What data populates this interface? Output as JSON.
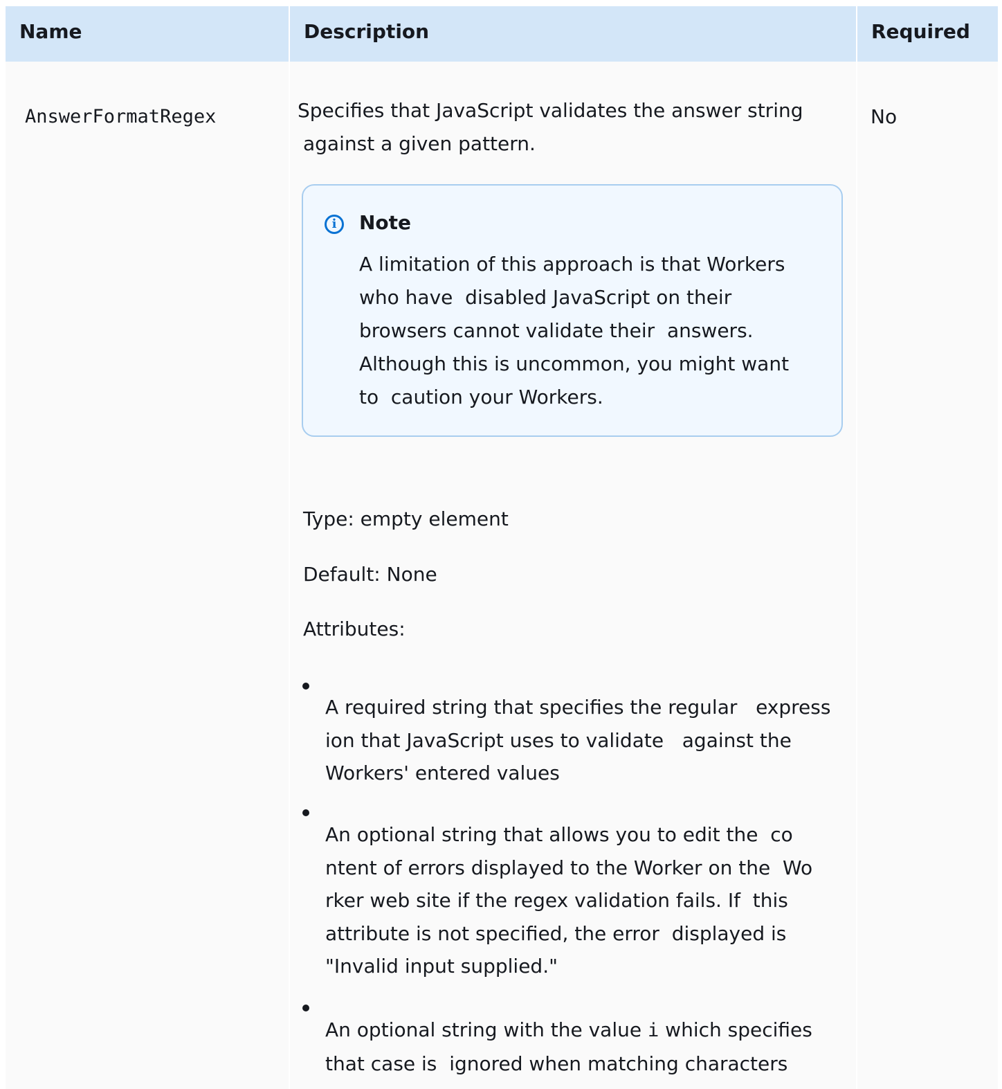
{
  "header": {
    "name": "Name",
    "description": "Description",
    "required": "Required"
  },
  "row": {
    "name": "AnswerFormatRegex",
    "required": "No",
    "intro_line1": "Specifies that JavaScript validates the answer string",
    "intro_line2": "against a given pattern.",
    "note": {
      "title": "Note",
      "lines": [
        "A limitation of this approach is that Workers",
        "who have  disabled JavaScript on their",
        "browsers cannot validate their  answers.",
        "Although this is uncommon, you might want",
        "to  caution your Workers."
      ]
    },
    "type_text": "Type: empty element",
    "default_text": "Default: None",
    "attributes_label": "Attributes:",
    "list": [
      {
        "lines": [
          "A required string that specifies the regular   express",
          "ion that JavaScript uses to validate   against the",
          "Workers' entered values"
        ]
      },
      {
        "lines": [
          "An optional string that allows you to edit the  co",
          "ntent of errors displayed to the Worker on the  Wo",
          "rker web site if the regex validation fails. If  this",
          "attribute is not specified, the error  displayed is",
          "\"Invalid input supplied.\""
        ]
      },
      {
        "line1_before": "An optional string with the value ",
        "line1_code": "i",
        "line1_after": " which specifies",
        "line2": "that case is  ignored when matching characters"
      }
    ]
  }
}
